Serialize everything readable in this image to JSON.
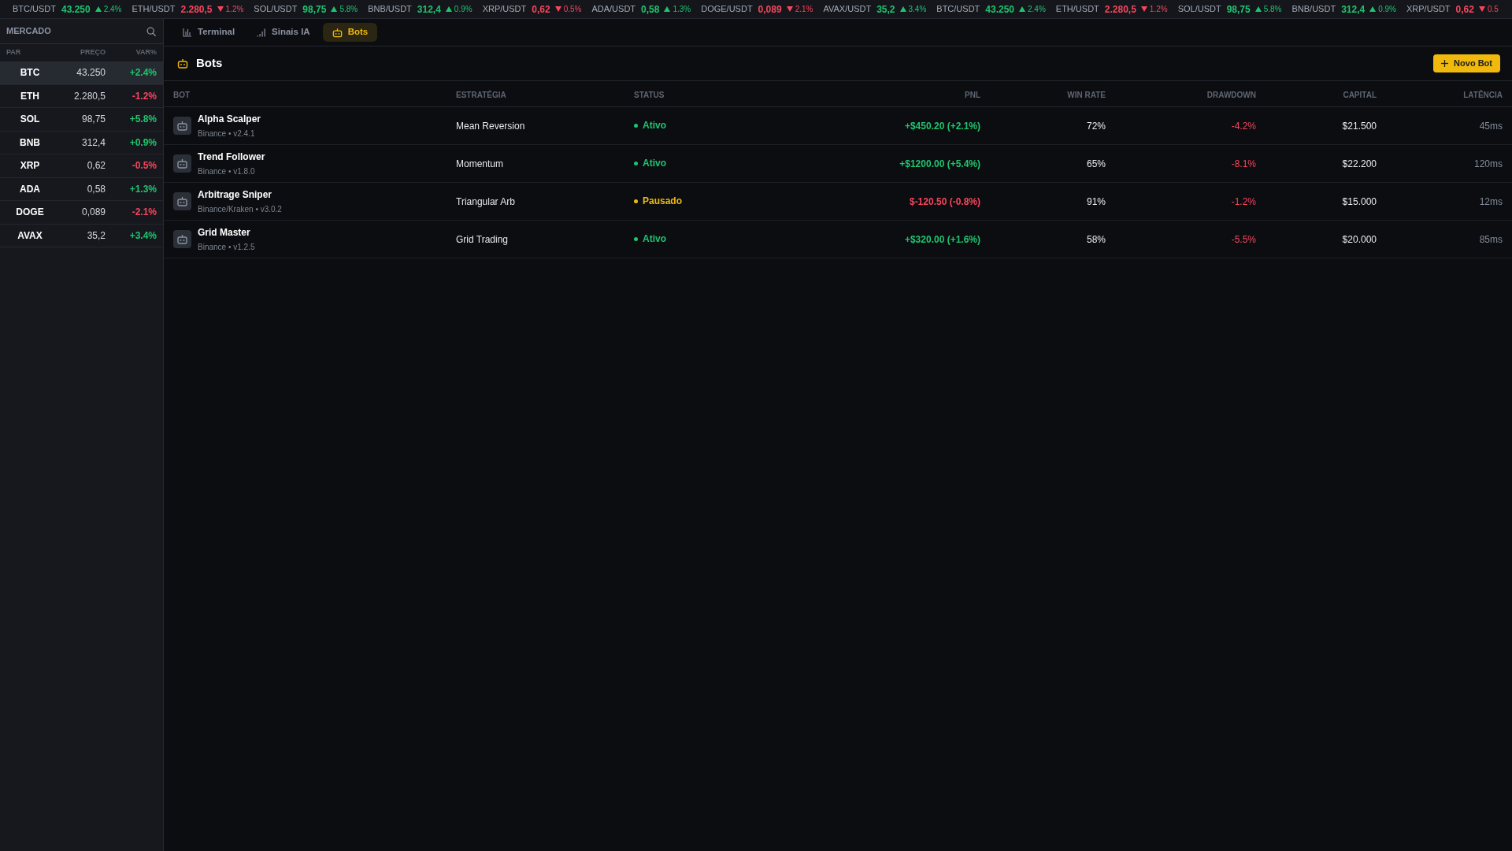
{
  "ticker": [
    {
      "pair": "BTC/USDT",
      "price": "43.250",
      "change": "2.4%",
      "rising": true
    },
    {
      "pair": "ETH/USDT",
      "price": "2.280,5",
      "change": "1.2%",
      "rising": false
    },
    {
      "pair": "SOL/USDT",
      "price": "98,75",
      "change": "5.8%",
      "rising": true
    },
    {
      "pair": "BNB/USDT",
      "price": "312,4",
      "change": "0.9%",
      "rising": true
    },
    {
      "pair": "XRP/USDT",
      "price": "0,62",
      "change": "0.5%",
      "rising": false
    },
    {
      "pair": "ADA/USDT",
      "price": "0,58",
      "change": "1.3%",
      "rising": true
    },
    {
      "pair": "DOGE/USDT",
      "price": "0,089",
      "change": "2.1%",
      "rising": false
    },
    {
      "pair": "AVAX/USDT",
      "price": "35,2",
      "change": "3.4%",
      "rising": true
    },
    {
      "pair": "BTC/USDT",
      "price": "43.250",
      "change": "2.4%",
      "rising": true
    },
    {
      "pair": "ETH/USDT",
      "price": "2.280,5",
      "change": "1.2%",
      "rising": false
    },
    {
      "pair": "SOL/USDT",
      "price": "98,75",
      "change": "5.8%",
      "rising": true
    },
    {
      "pair": "BNB/USDT",
      "price": "312,4",
      "change": "0.9%",
      "rising": true
    },
    {
      "pair": "XRP/USDT",
      "price": "0,62",
      "change": "0.5",
      "rising": false
    }
  ],
  "market": {
    "title": "MERCADO",
    "columns": [
      "PAR",
      "PREÇO",
      "VAR%"
    ],
    "rows": [
      {
        "symbol": "BTC",
        "price": "43.250",
        "change": "+2.4%",
        "rising": true,
        "selected": true
      },
      {
        "symbol": "ETH",
        "price": "2.280,5",
        "change": "-1.2%",
        "rising": false,
        "selected": false
      },
      {
        "symbol": "SOL",
        "price": "98,75",
        "change": "+5.8%",
        "rising": true,
        "selected": false
      },
      {
        "symbol": "BNB",
        "price": "312,4",
        "change": "+0.9%",
        "rising": true,
        "selected": false
      },
      {
        "symbol": "XRP",
        "price": "0,62",
        "change": "-0.5%",
        "rising": false,
        "selected": false
      },
      {
        "symbol": "ADA",
        "price": "0,58",
        "change": "+1.3%",
        "rising": true,
        "selected": false
      },
      {
        "symbol": "DOGE",
        "price": "0,089",
        "change": "-2.1%",
        "rising": false,
        "selected": false
      },
      {
        "symbol": "AVAX",
        "price": "35,2",
        "change": "+3.4%",
        "rising": true,
        "selected": false
      }
    ]
  },
  "tabs": [
    {
      "label": "Terminal",
      "selected": false
    },
    {
      "label": "Sinais IA",
      "selected": false
    },
    {
      "label": "Bots",
      "selected": true
    }
  ],
  "panel": {
    "title": "Bots",
    "new_button": "Novo Bot"
  },
  "table": {
    "columns": [
      "BOT",
      "ESTRATÉGIA",
      "STATUS",
      "PNL",
      "WIN RATE",
      "DRAWDOWN",
      "CAPITAL",
      "LATÊNCIA"
    ],
    "rows": [
      {
        "name": "Alpha Scalper",
        "details": "Binance • v2.4.1",
        "strategy": "Mean Reversion",
        "status": {
          "label": "Ativo",
          "kind": "active"
        },
        "pnl": "+$450.20 (+2.1%)",
        "pnl_rising": true,
        "win_rate": "72%",
        "drawdown": "-4.2%",
        "capital": "$21.500",
        "latency": "45ms"
      },
      {
        "name": "Trend Follower",
        "details": "Binance • v1.8.0",
        "strategy": "Momentum",
        "status": {
          "label": "Ativo",
          "kind": "active"
        },
        "pnl": "+$1200.00 (+5.4%)",
        "pnl_rising": true,
        "win_rate": "65%",
        "drawdown": "-8.1%",
        "capital": "$22.200",
        "latency": "120ms"
      },
      {
        "name": "Arbitrage Sniper",
        "details": "Binance/Kraken • v3.0.2",
        "strategy": "Triangular Arb",
        "status": {
          "label": "Pausado",
          "kind": "paused"
        },
        "pnl": "$-120.50 (-0.8%)",
        "pnl_rising": false,
        "win_rate": "91%",
        "drawdown": "-1.2%",
        "capital": "$15.000",
        "latency": "12ms"
      },
      {
        "name": "Grid Master",
        "details": "Binance • v1.2.5",
        "strategy": "Grid Trading",
        "status": {
          "label": "Ativo",
          "kind": "active"
        },
        "pnl": "+$320.00 (+1.6%)",
        "pnl_rising": true,
        "win_rate": "58%",
        "drawdown": "-5.5%",
        "capital": "$20.000",
        "latency": "85ms"
      }
    ]
  }
}
